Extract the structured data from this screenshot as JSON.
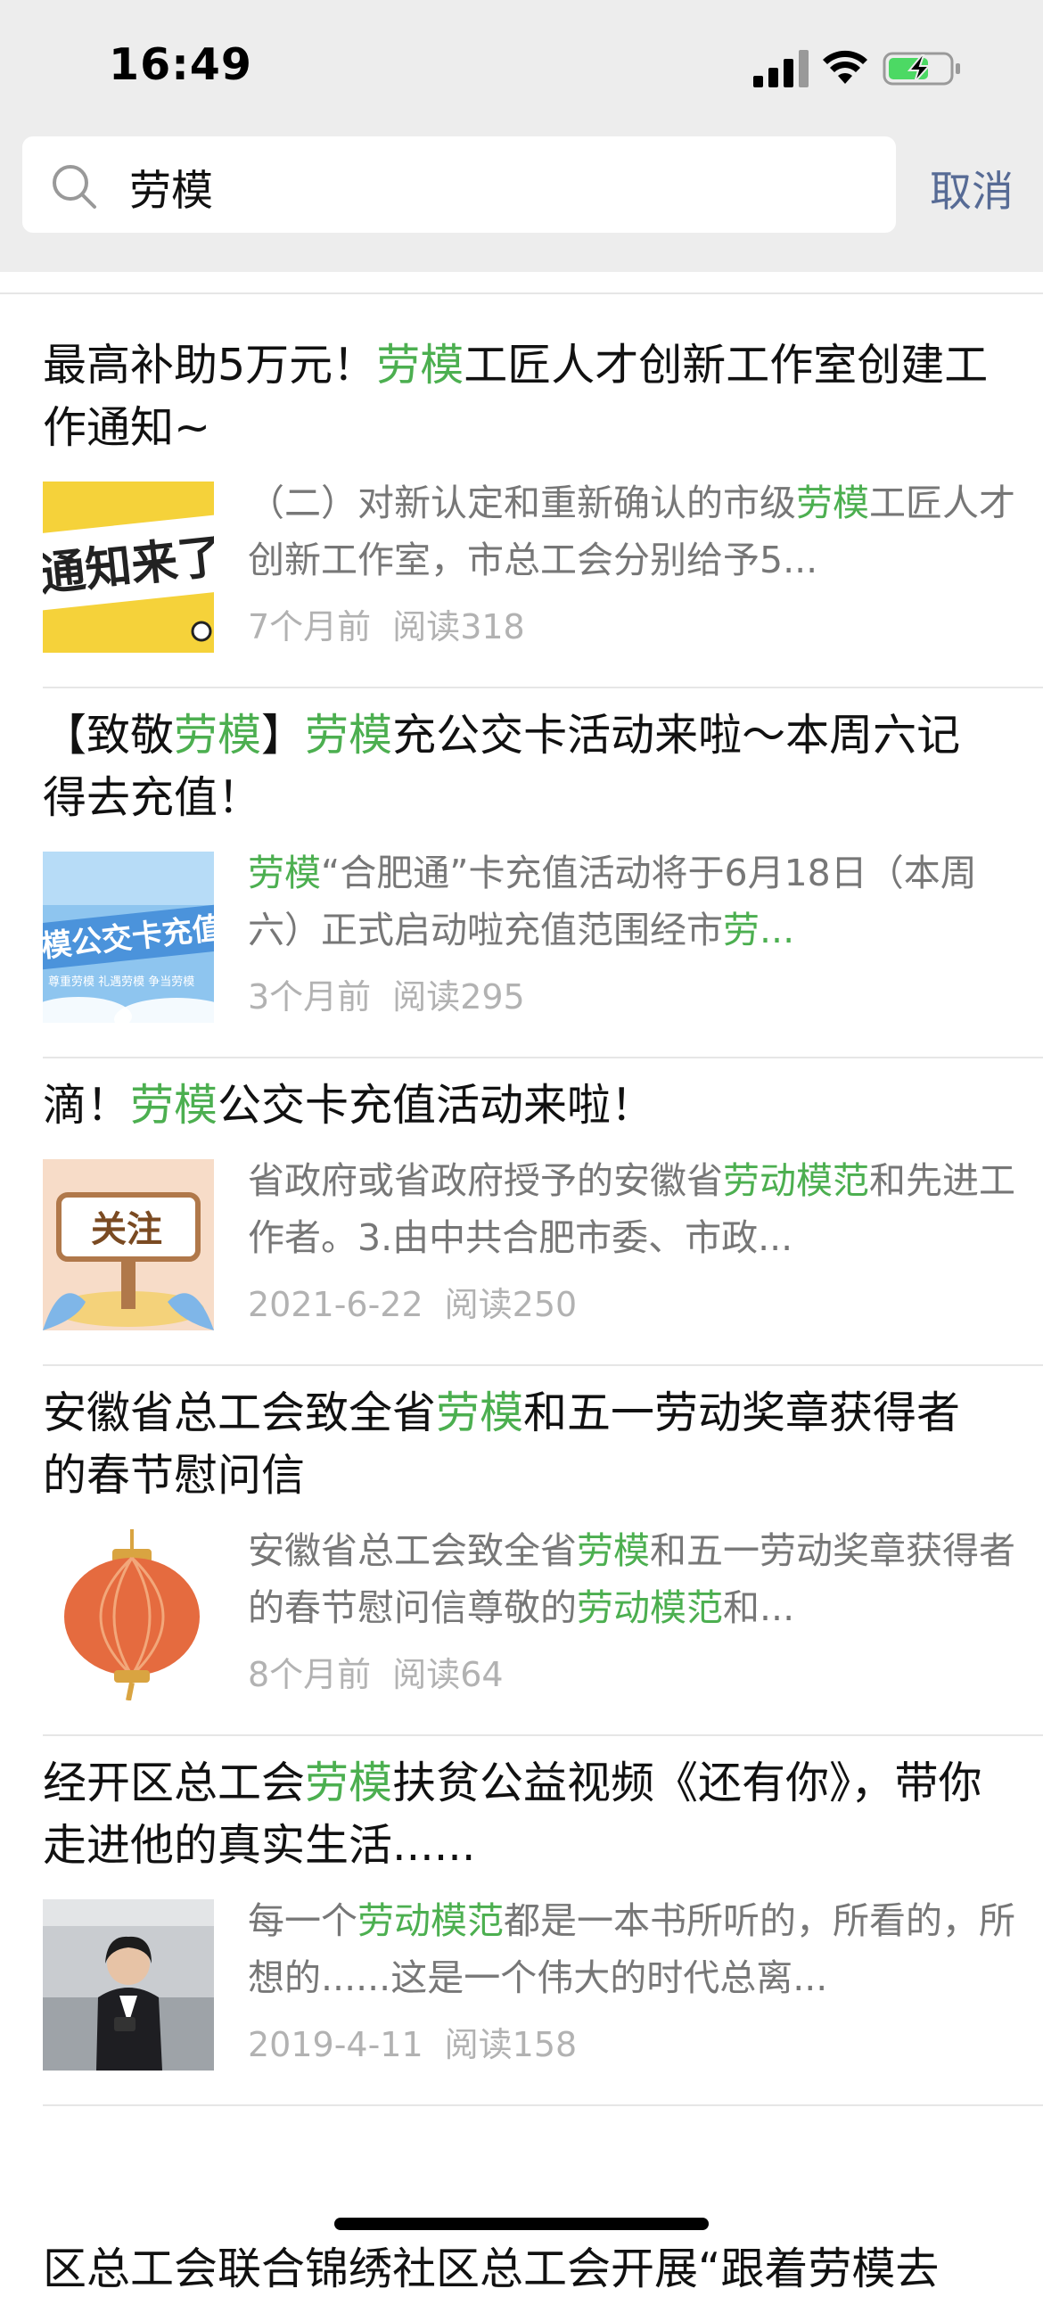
{
  "status": {
    "time": "16:49"
  },
  "search": {
    "query": "劳模",
    "cancel_label": "取消"
  },
  "results": [
    {
      "title_parts": [
        {
          "text": "最高补助5万元！",
          "hl": false
        },
        {
          "text": "劳模",
          "hl": true
        },
        {
          "text": "工匠人才创新工作室创建工作通知~",
          "hl": false
        }
      ],
      "summary_parts": [
        {
          "text": "（二）对新认定和重新确认的市级",
          "hl": false
        },
        {
          "text": "劳模",
          "hl": true
        },
        {
          "text": "工匠人才创新工作室，市总工会分别给予5...",
          "hl": false
        }
      ],
      "time": "7个月前",
      "reads": "阅读318",
      "thumb_text": "通知来了",
      "thumb_style": "notice"
    },
    {
      "title_parts": [
        {
          "text": "【致敬",
          "hl": false
        },
        {
          "text": "劳模",
          "hl": true
        },
        {
          "text": "】",
          "hl": false
        },
        {
          "text": "劳模",
          "hl": true
        },
        {
          "text": "充公交卡活动来啦～本周六记得去充值！",
          "hl": false
        }
      ],
      "summary_parts": [
        {
          "text": "劳模",
          "hl": true
        },
        {
          "text": "“合肥通”卡充值活动将于6月18日（本周六）正式启动啦充值范围经市",
          "hl": false
        },
        {
          "text": "劳...",
          "hl": true
        }
      ],
      "time": "3个月前",
      "reads": "阅读295",
      "thumb_text": "模公交卡充值",
      "thumb_sub": "尊重劳模 礼遇劳模 争当劳模",
      "thumb_style": "bus"
    },
    {
      "title_parts": [
        {
          "text": "滴！",
          "hl": false
        },
        {
          "text": "劳模",
          "hl": true
        },
        {
          "text": "公交卡充值活动来啦！",
          "hl": false
        }
      ],
      "summary_parts": [
        {
          "text": "省政府或省政府授予的安徽省",
          "hl": false
        },
        {
          "text": "劳动模范",
          "hl": true
        },
        {
          "text": "和先进工作者。3.由中共合肥市委、市政...",
          "hl": false
        }
      ],
      "time": "2021-6-22",
      "reads": "阅读250",
      "thumb_text": "关注",
      "thumb_style": "sign"
    },
    {
      "title_parts": [
        {
          "text": "安徽省总工会致全省",
          "hl": false
        },
        {
          "text": "劳模",
          "hl": true
        },
        {
          "text": "和五一劳动奖章获得者的春节慰问信",
          "hl": false
        }
      ],
      "summary_parts": [
        {
          "text": "安徽省总工会致全省",
          "hl": false
        },
        {
          "text": "劳模",
          "hl": true
        },
        {
          "text": "和五一劳动奖章获得者的春节慰问信尊敬的",
          "hl": false
        },
        {
          "text": "劳动模范",
          "hl": true
        },
        {
          "text": "和...",
          "hl": false
        }
      ],
      "time": "8个月前",
      "reads": "阅读64",
      "thumb_style": "lantern"
    },
    {
      "title_parts": [
        {
          "text": "经开区总工会",
          "hl": false
        },
        {
          "text": "劳模",
          "hl": true
        },
        {
          "text": "扶贫公益视频《还有你》，带你走进他的真实生活......",
          "hl": false
        }
      ],
      "summary_parts": [
        {
          "text": "每一个",
          "hl": false
        },
        {
          "text": "劳动模范",
          "hl": true
        },
        {
          "text": "都是一本书所听的，所看的，所想的......这是一个伟大的时代总离...",
          "hl": false
        }
      ],
      "time": "2019-4-11",
      "reads": "阅读158",
      "thumb_style": "person"
    }
  ],
  "partial_next_title": "区总工会联合锦绣社区总工会开展“跟着劳模去"
}
